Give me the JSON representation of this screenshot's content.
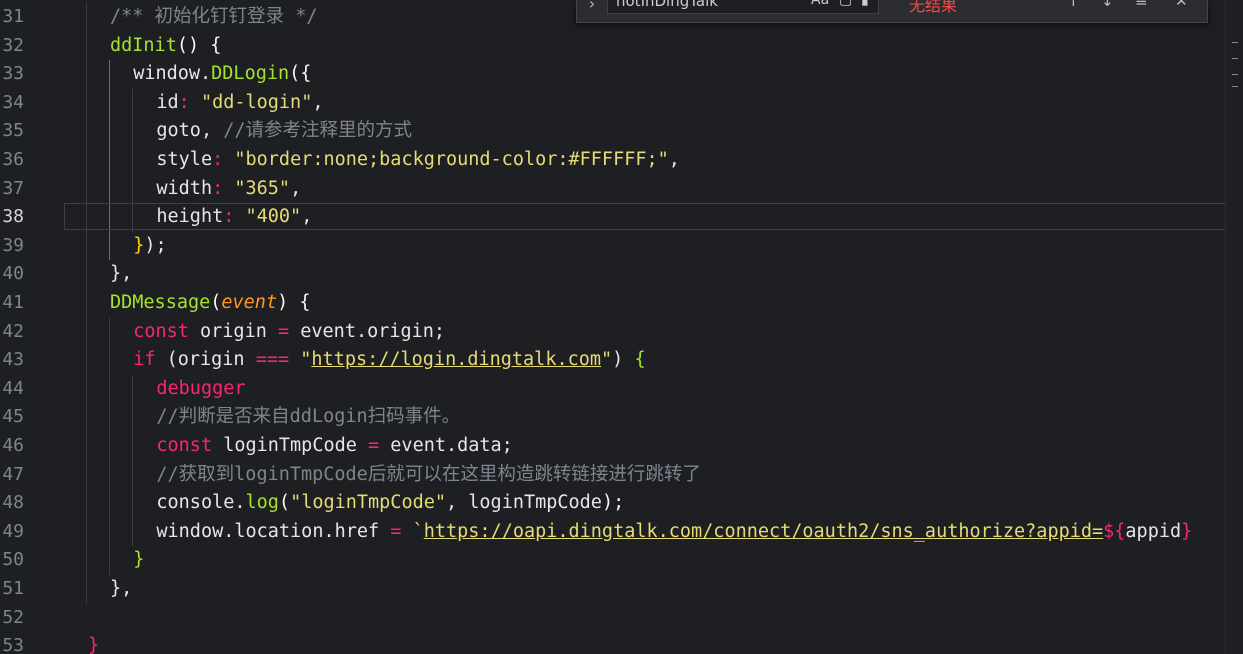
{
  "editor": {
    "line_numbers": [
      "31",
      "32",
      "33",
      "34",
      "35",
      "36",
      "37",
      "38",
      "39",
      "40",
      "41",
      "42",
      "43",
      "44",
      "45",
      "46",
      "47",
      "48",
      "49",
      "50",
      "51",
      "52",
      "53"
    ],
    "active_line": "38",
    "lines": [
      {
        "indent": 1,
        "tokens": [
          {
            "t": "/** 初始化钉钉登录 */",
            "c": "comment"
          }
        ]
      },
      {
        "indent": 1,
        "tokens": [
          {
            "t": "ddInit",
            "c": "fn"
          },
          {
            "t": "() {",
            "c": "brace"
          }
        ]
      },
      {
        "indent": 2,
        "tokens": [
          {
            "t": "window.",
            "c": "plain"
          },
          {
            "t": "DDLogin",
            "c": "method"
          },
          {
            "t": "(",
            "c": "brace"
          },
          {
            "t": "{",
            "c": "brace"
          }
        ]
      },
      {
        "indent": 3,
        "tokens": [
          {
            "t": "id",
            "c": "prop"
          },
          {
            "t": ": ",
            "c": "op"
          },
          {
            "t": "\"dd-login\"",
            "c": "str"
          },
          {
            "t": ",",
            "c": "plain"
          }
        ]
      },
      {
        "indent": 3,
        "tokens": [
          {
            "t": "goto, ",
            "c": "plain"
          },
          {
            "t": "//请参考注释里的方式",
            "c": "comment"
          }
        ]
      },
      {
        "indent": 3,
        "tokens": [
          {
            "t": "style",
            "c": "prop"
          },
          {
            "t": ": ",
            "c": "op"
          },
          {
            "t": "\"border:none;background-color:#FFFFFF;\"",
            "c": "str"
          },
          {
            "t": ",",
            "c": "plain"
          }
        ]
      },
      {
        "indent": 3,
        "tokens": [
          {
            "t": "width",
            "c": "prop"
          },
          {
            "t": ": ",
            "c": "op"
          },
          {
            "t": "\"365\"",
            "c": "str"
          },
          {
            "t": ",",
            "c": "plain"
          }
        ]
      },
      {
        "indent": 3,
        "tokens": [
          {
            "t": "height",
            "c": "prop"
          },
          {
            "t": ": ",
            "c": "op"
          },
          {
            "t": "\"400\"",
            "c": "str"
          },
          {
            "t": ",",
            "c": "plain"
          }
        ]
      },
      {
        "indent": 2,
        "tokens": [
          {
            "t": "}",
            "c": "bracket-y"
          },
          {
            "t": ");",
            "c": "plain"
          }
        ]
      },
      {
        "indent": 1,
        "tokens": [
          {
            "t": "},",
            "c": "plain"
          }
        ]
      },
      {
        "indent": 1,
        "tokens": [
          {
            "t": "DDMessage",
            "c": "fn"
          },
          {
            "t": "(",
            "c": "brace"
          },
          {
            "t": "event",
            "c": "param"
          },
          {
            "t": ") {",
            "c": "brace"
          }
        ]
      },
      {
        "indent": 2,
        "tokens": [
          {
            "t": "const ",
            "c": "kw"
          },
          {
            "t": "origin ",
            "c": "plain"
          },
          {
            "t": "= ",
            "c": "op"
          },
          {
            "t": "event.origin;",
            "c": "plain"
          }
        ]
      },
      {
        "indent": 2,
        "tokens": [
          {
            "t": "if ",
            "c": "kw"
          },
          {
            "t": "(origin ",
            "c": "plain"
          },
          {
            "t": "=== ",
            "c": "op"
          },
          {
            "t": "\"",
            "c": "str"
          },
          {
            "t": "https://login.dingtalk.com",
            "c": "url"
          },
          {
            "t": "\"",
            "c": "str"
          },
          {
            "t": ") ",
            "c": "plain"
          },
          {
            "t": "{",
            "c": "bracket-g"
          }
        ]
      },
      {
        "indent": 3,
        "tokens": [
          {
            "t": "debugger",
            "c": "dbg"
          }
        ]
      },
      {
        "indent": 3,
        "tokens": [
          {
            "t": "//判断是否来自ddLogin扫码事件。",
            "c": "comment"
          }
        ]
      },
      {
        "indent": 3,
        "tokens": [
          {
            "t": "const ",
            "c": "kw"
          },
          {
            "t": "loginTmpCode ",
            "c": "plain"
          },
          {
            "t": "= ",
            "c": "op"
          },
          {
            "t": "event.data;",
            "c": "plain"
          }
        ]
      },
      {
        "indent": 3,
        "tokens": [
          {
            "t": "//获取到loginTmpCode后就可以在这里构造跳转链接进行跳转了",
            "c": "comment"
          }
        ]
      },
      {
        "indent": 3,
        "tokens": [
          {
            "t": "console.",
            "c": "plain"
          },
          {
            "t": "log",
            "c": "method"
          },
          {
            "t": "(",
            "c": "brace"
          },
          {
            "t": "\"loginTmpCode\"",
            "c": "str"
          },
          {
            "t": ", loginTmpCode",
            "c": "plain"
          },
          {
            "t": ");",
            "c": "brace"
          }
        ]
      },
      {
        "indent": 3,
        "tokens": [
          {
            "t": "window.location.href ",
            "c": "plain"
          },
          {
            "t": "= ",
            "c": "op"
          },
          {
            "t": "`",
            "c": "str"
          },
          {
            "t": "https://oapi.dingtalk.com/connect/oauth2/sns_authorize?appid=",
            "c": "url"
          },
          {
            "t": "${",
            "c": "interp"
          },
          {
            "t": "appid",
            "c": "plain"
          },
          {
            "t": "}",
            "c": "interp"
          }
        ]
      },
      {
        "indent": 2,
        "tokens": [
          {
            "t": "}",
            "c": "bracket-g"
          }
        ]
      },
      {
        "indent": 1,
        "tokens": [
          {
            "t": "},",
            "c": "plain"
          }
        ]
      },
      {
        "indent": 0,
        "tokens": [
          {
            "t": "",
            "c": "plain"
          }
        ]
      },
      {
        "indent": 0,
        "tokens": [
          {
            "t": "}",
            "c": "kw"
          }
        ]
      }
    ]
  },
  "find_widget": {
    "expand_icon": "chevron-right-icon",
    "search_value": "notInDingTalk",
    "match_case_label": "Aa",
    "whole_word_icon": "whole-word-icon",
    "regex_icon": "regex-icon",
    "result_text": "无结果",
    "prev_icon": "arrow-up-icon",
    "next_icon": "arrow-down-icon",
    "selection_icon": "find-in-selection-icon",
    "close_icon": "close-icon"
  }
}
